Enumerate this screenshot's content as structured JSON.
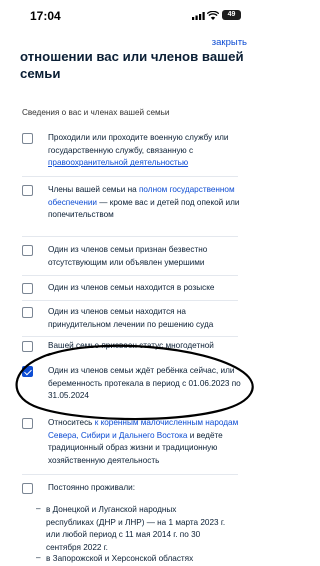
{
  "status_bar": {
    "time": "17:04",
    "battery": "49"
  },
  "header": {
    "close_label": "закрыть",
    "title": "отношении вас или членов вашей семьи"
  },
  "section": {
    "label": "Сведения о вас и членах вашей семьи"
  },
  "items": [
    {
      "pre": "Проходили или проходите военную службу или государственную службу, связанную с ",
      "link": "правоохранительной деятельностью",
      "post": "",
      "checked": false
    },
    {
      "pre": "Члены вашей семьи на ",
      "link": "полном государственном обеспечении",
      "post": " — кроме вас и детей под опекой или попечительством",
      "checked": false
    },
    {
      "pre": "Один из членов семьи признан безвестно отсутствующим или объявлен умершими",
      "link": "",
      "post": "",
      "checked": false
    },
    {
      "pre": "Один из членов семьи находится в розыске",
      "link": "",
      "post": "",
      "checked": false
    },
    {
      "pre": "Один из членов семьи находится на принудительном лечении по решению суда",
      "link": "",
      "post": "",
      "checked": false
    },
    {
      "pre": "Вашей семье присвоен статус многодетной",
      "link": "",
      "post": "",
      "checked": false
    },
    {
      "pre": "Один из членов семьи ждёт ребёнка сейчас, или беременность протекала в период с 01.06.2023 по 31.05.2024",
      "link": "",
      "post": "",
      "checked": true
    },
    {
      "pre": "Относитесь ",
      "link": "к коренным малочисленным народам Севера, Сибири и Дальнего Востока",
      "post": " и ведёте традиционный образ жизни и традиционную хозяйственную деятельность",
      "checked": false
    },
    {
      "pre": "Постоянно проживали:",
      "link": "",
      "post": "",
      "checked": false
    }
  ],
  "residence_bullets": [
    "в Донецкой и Луганской народных республиках (ДНР и ЛНР) — на 1 марта 2023 г. или любой период с 11 мая 2014 г. по 30 сентября 2022 г.",
    "в Запорожской и Херсонской областях"
  ],
  "colors": {
    "accent": "#0d4cd3",
    "text": "#0b1f35"
  }
}
